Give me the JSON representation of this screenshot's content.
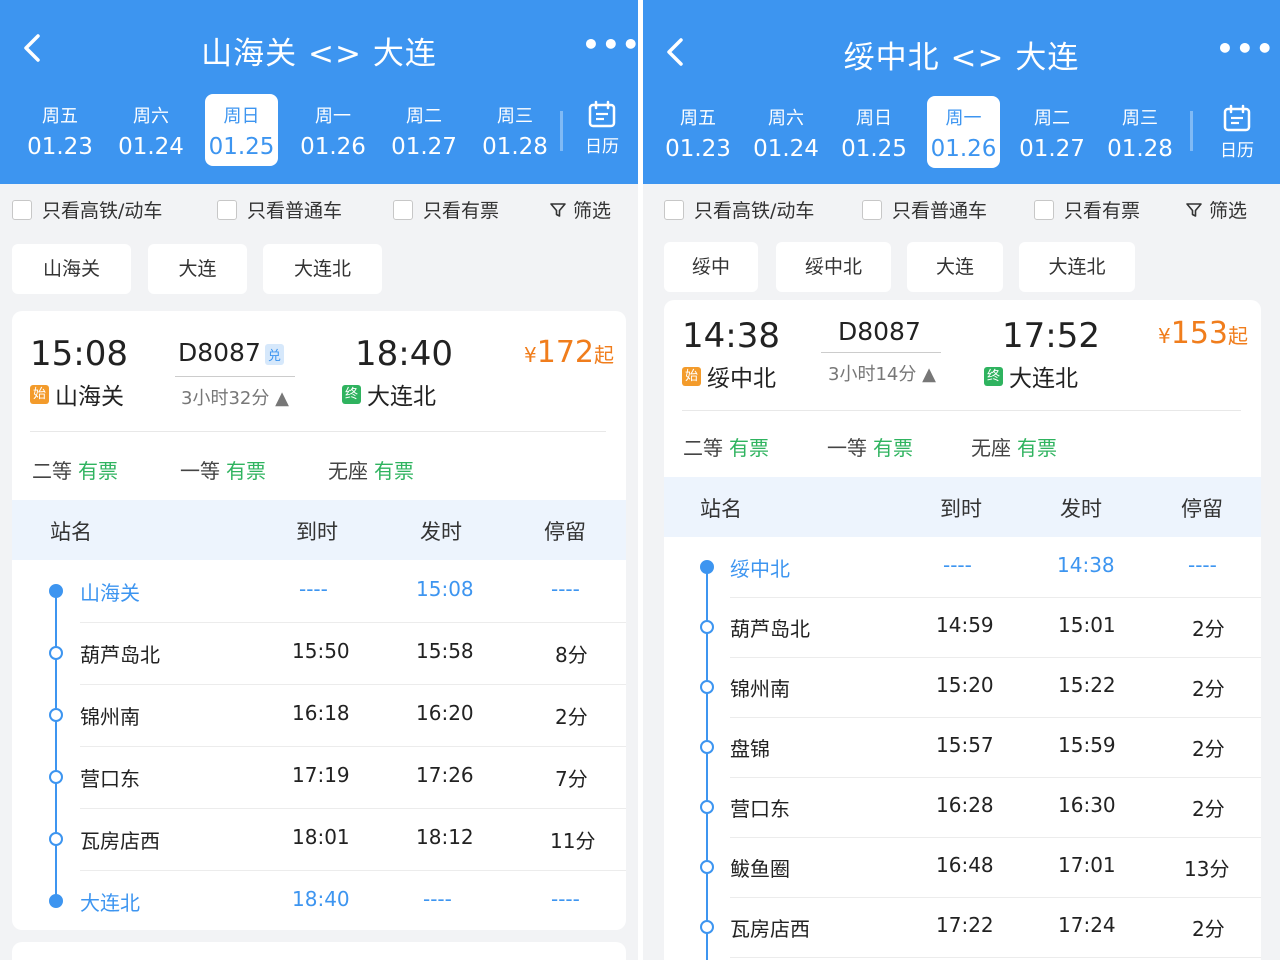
{
  "left": {
    "title": "山海关 <> 大连",
    "dates": [
      {
        "wd": "周五",
        "md": "01.23"
      },
      {
        "wd": "周六",
        "md": "01.24"
      },
      {
        "wd": "周日",
        "md": "01.25"
      },
      {
        "wd": "周一",
        "md": "01.26"
      },
      {
        "wd": "周二",
        "md": "01.27"
      },
      {
        "wd": "周三",
        "md": "01.28"
      }
    ],
    "selected_date_index": 2,
    "calendar_label": "日历",
    "filters": {
      "gaotie": "只看高铁/动车",
      "putong": "只看普通车",
      "youpiao": "只看有票",
      "shaixuan": "筛选"
    },
    "chips": [
      "山海关",
      "大连",
      "大连北"
    ],
    "train": {
      "dep_time": "15:08",
      "dep_tag": "始",
      "dep_station": "山海关",
      "number": "D8087",
      "badge": "兑",
      "duration": "3小时32分 ▲",
      "arr_time": "18:40",
      "arr_tag": "终",
      "arr_station": "大连北",
      "price_symbol": "¥",
      "price": "172",
      "price_suffix": "起"
    },
    "seats": [
      {
        "cls": "二等",
        "status": "有票"
      },
      {
        "cls": "一等",
        "status": "有票"
      },
      {
        "cls": "无座",
        "status": "有票"
      }
    ],
    "table_headers": {
      "name": "站名",
      "arr": "到时",
      "dep": "发时",
      "stay": "停留"
    },
    "stops": [
      {
        "name": "山海关",
        "arr": "----",
        "dep": "15:08",
        "stay": "----"
      },
      {
        "name": "葫芦岛北",
        "arr": "15:50",
        "dep": "15:58",
        "stay": "8分"
      },
      {
        "name": "锦州南",
        "arr": "16:18",
        "dep": "16:20",
        "stay": "2分"
      },
      {
        "name": "营口东",
        "arr": "17:19",
        "dep": "17:26",
        "stay": "7分"
      },
      {
        "name": "瓦房店西",
        "arr": "18:01",
        "dep": "18:12",
        "stay": "11分"
      },
      {
        "name": "大连北",
        "arr": "18:40",
        "dep": "----",
        "stay": "----"
      }
    ]
  },
  "right": {
    "title": "绥中北 <> 大连",
    "dates": [
      {
        "wd": "周五",
        "md": "01.23"
      },
      {
        "wd": "周六",
        "md": "01.24"
      },
      {
        "wd": "周日",
        "md": "01.25"
      },
      {
        "wd": "周一",
        "md": "01.26"
      },
      {
        "wd": "周二",
        "md": "01.27"
      },
      {
        "wd": "周三",
        "md": "01.28"
      }
    ],
    "selected_date_index": 3,
    "calendar_label": "日历",
    "filters": {
      "gaotie": "只看高铁/动车",
      "putong": "只看普通车",
      "youpiao": "只看有票",
      "shaixuan": "筛选"
    },
    "chips": [
      "绥中",
      "绥中北",
      "大连",
      "大连北"
    ],
    "train": {
      "dep_time": "14:38",
      "dep_tag": "始",
      "dep_station": "绥中北",
      "number": "D8087",
      "duration": "3小时14分 ▲",
      "arr_time": "17:52",
      "arr_tag": "终",
      "arr_station": "大连北",
      "price_symbol": "¥",
      "price": "153",
      "price_suffix": "起"
    },
    "seats": [
      {
        "cls": "二等",
        "status": "有票"
      },
      {
        "cls": "一等",
        "status": "有票"
      },
      {
        "cls": "无座",
        "status": "有票"
      }
    ],
    "table_headers": {
      "name": "站名",
      "arr": "到时",
      "dep": "发时",
      "stay": "停留"
    },
    "stops": [
      {
        "name": "绥中北",
        "arr": "----",
        "dep": "14:38",
        "stay": "----"
      },
      {
        "name": "葫芦岛北",
        "arr": "14:59",
        "dep": "15:01",
        "stay": "2分"
      },
      {
        "name": "锦州南",
        "arr": "15:20",
        "dep": "15:22",
        "stay": "2分"
      },
      {
        "name": "盘锦",
        "arr": "15:57",
        "dep": "15:59",
        "stay": "2分"
      },
      {
        "name": "营口东",
        "arr": "16:28",
        "dep": "16:30",
        "stay": "2分"
      },
      {
        "name": "鲅鱼圈",
        "arr": "16:48",
        "dep": "17:01",
        "stay": "13分"
      },
      {
        "name": "瓦房店西",
        "arr": "17:22",
        "dep": "17:24",
        "stay": "2分"
      }
    ]
  },
  "colors": {
    "header_blue": "#3d95f0",
    "price_orange": "#f07d1c",
    "available_green": "#2fb35f",
    "start_tag": "#f39b2b",
    "end_tag": "#2fb35f"
  },
  "icons": [
    "back-arrow-icon",
    "more-dots-icon",
    "calendar-icon",
    "checkbox-icon",
    "filter-funnel-icon",
    "start-tag-icon",
    "end-tag-icon",
    "exchange-badge-icon",
    "timeline-dot-icon"
  ]
}
